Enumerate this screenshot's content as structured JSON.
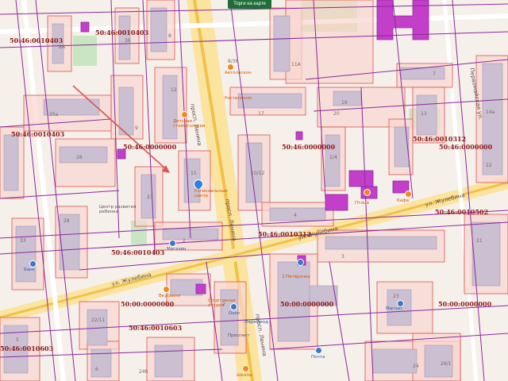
{
  "toolbar": {
    "torgi_button": "Торги на карте"
  },
  "cadastral_labels": [
    "50:46:0010403",
    "50:46:0010403",
    "50:46:0010403",
    "50:46:0000000",
    "50:46:0000000",
    "50:46:0010312",
    "50:46:0000000",
    "50:46:0010502",
    "50:46:0010312",
    "50:46:0010403",
    "50:00:0000000",
    "50:00:0000000",
    "50:00:0000000",
    "50:46:0010603",
    "50:46:0010603"
  ],
  "streets": {
    "lenina_1": "просп. Ленина",
    "lenina_2": "просп. Ленина",
    "lenina_3": "просп. Ленина",
    "zhulebina_1": "ул. Жулебина",
    "zhulebina_2": "ул. Жулебина",
    "zhulebina_3": "ул. Жулебина",
    "pervomayskaya": "Первомайская ул."
  },
  "house_numbers": [
    "8А",
    "36",
    "25а",
    "28",
    "17",
    "11А",
    "8/36",
    "12",
    "9",
    "23",
    "15",
    "10/12",
    "19",
    "1/4",
    "4",
    "3",
    "22",
    "21",
    "23",
    "26/1",
    "28",
    "24б",
    "2",
    "22/11",
    "5",
    "1",
    "2",
    "13",
    "20",
    "7",
    "33",
    "14а",
    "24",
    "8",
    "6"
  ],
  "pois": {
    "autolab": "Автоласкон",
    "rostelecom": "Ростелеком",
    "dentist": "Детская\nстоматология",
    "mfc": "Региональный\nцентр",
    "center": "Центр развития\nребенка",
    "magnit": "Магазин",
    "pyaterochka": "Пятёрочка",
    "fitness": "Спортивная\nстудия",
    "vkusvill": "Вкусвилл",
    "ozon": "Ozon",
    "pharmacy": "Фармленд",
    "ptica": "Птица",
    "cafe": "Кафе",
    "shop2": "Магнит",
    "bank": "Банк",
    "post": "Почта",
    "school": "Школа",
    "prospect": "Проспект"
  },
  "colors": {
    "parcel_border": "#d9534f",
    "cadastral_line": "#8a2a9c",
    "road_main": "#f5d36a",
    "accent": "#c43fc9"
  }
}
